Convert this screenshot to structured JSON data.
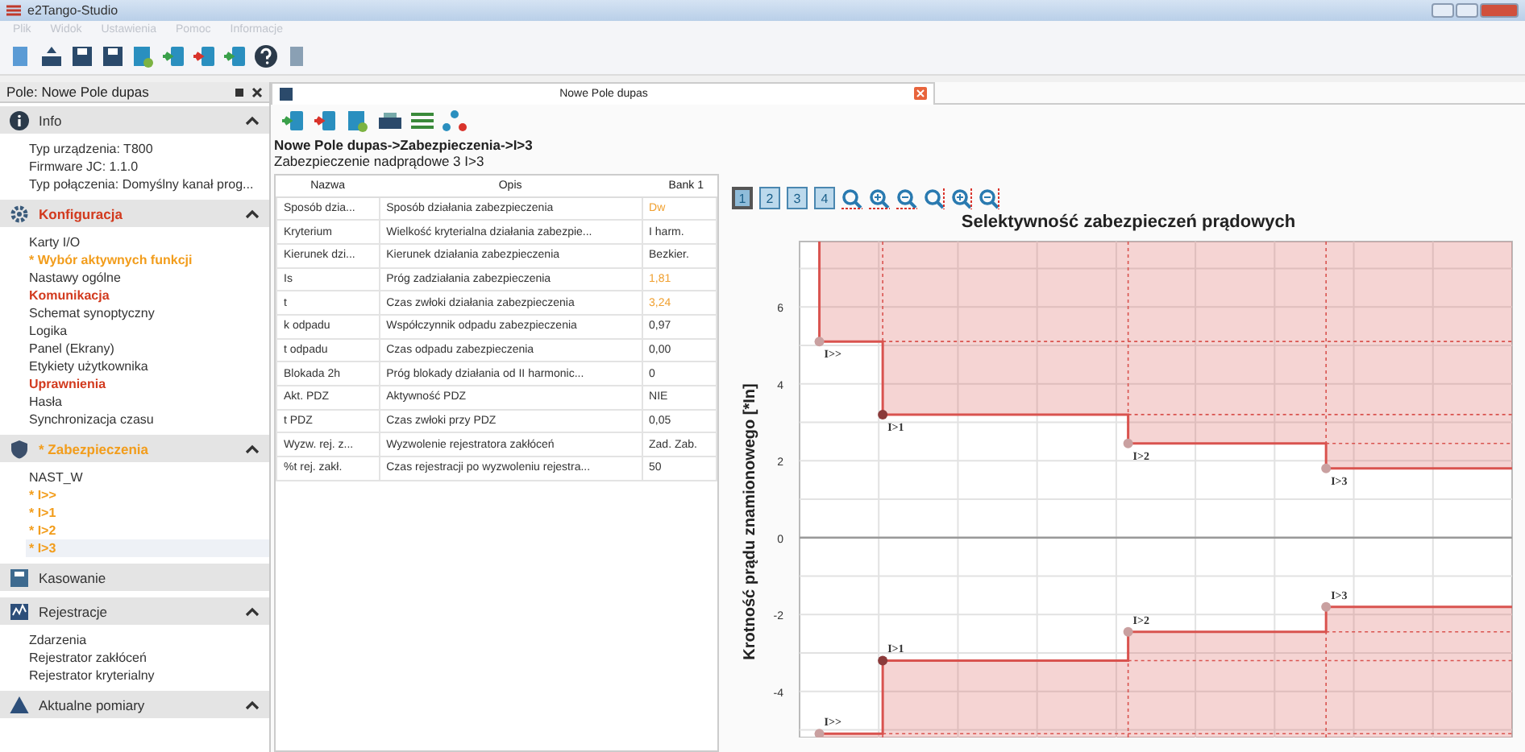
{
  "window": {
    "title": "e2Tango-Studio"
  },
  "menu": [
    "Plik",
    "Widok",
    "Ustawienia",
    "Pomoc",
    "Informacje"
  ],
  "sidebar": {
    "title": "Pole: Nowe Pole dupas",
    "sections": [
      {
        "title": "Info",
        "kind": "normal",
        "expanded": true,
        "items": [
          {
            "label": "Typ urządzenia: T800",
            "kind": "normal",
            "selected": false
          },
          {
            "label": "Firmware JC: 1.1.0",
            "kind": "normal",
            "selected": false
          },
          {
            "label": "Typ połączenia: Domyślny kanał prog...",
            "kind": "normal",
            "selected": false
          }
        ]
      },
      {
        "title": "Konfiguracja",
        "kind": "error",
        "expanded": true,
        "items": [
          {
            "label": "Karty I/O",
            "kind": "normal",
            "selected": false
          },
          {
            "label": "* Wybór aktywnych funkcji",
            "kind": "modified",
            "selected": false
          },
          {
            "label": "Nastawy ogólne",
            "kind": "normal",
            "selected": false
          },
          {
            "label": "Komunikacja",
            "kind": "error",
            "selected": false
          },
          {
            "label": "Schemat synoptyczny",
            "kind": "normal",
            "selected": false
          },
          {
            "label": "Logika",
            "kind": "normal",
            "selected": false
          },
          {
            "label": "Panel (Ekrany)",
            "kind": "normal",
            "selected": false
          },
          {
            "label": "Etykiety użytkownika",
            "kind": "normal",
            "selected": false
          },
          {
            "label": "Uprawnienia",
            "kind": "error",
            "selected": false
          },
          {
            "label": "Hasła",
            "kind": "normal",
            "selected": false
          },
          {
            "label": "Synchronizacja czasu",
            "kind": "normal",
            "selected": false
          }
        ]
      },
      {
        "title": "* Zabezpieczenia",
        "kind": "modified",
        "expanded": true,
        "items": [
          {
            "label": "NAST_W",
            "kind": "normal",
            "selected": false
          },
          {
            "label": "* I>>",
            "kind": "modified",
            "selected": false
          },
          {
            "label": "* I>1",
            "kind": "modified",
            "selected": false
          },
          {
            "label": "* I>2",
            "kind": "modified",
            "selected": false
          },
          {
            "label": "* I>3",
            "kind": "modified",
            "selected": true
          }
        ]
      },
      {
        "title": "Kasowanie",
        "kind": "normal",
        "expanded": false
      },
      {
        "title": "Rejestracje",
        "kind": "normal",
        "expanded": true,
        "items": [
          {
            "label": "Zdarzenia",
            "kind": "normal",
            "selected": false
          },
          {
            "label": "Rejestrator zakłóceń",
            "kind": "normal",
            "selected": false
          },
          {
            "label": "Rejestrator kryterialny",
            "kind": "normal",
            "selected": false
          }
        ]
      },
      {
        "title": "Aktualne pomiary",
        "kind": "normal",
        "expanded": true
      }
    ]
  },
  "document": {
    "tab": {
      "title": "Nowe Pole dupas",
      "selected": true
    },
    "breadcrumb": "Nowe Pole dupas->Zabezpieczenia->I>3",
    "subtitle": "Zabezpieczenie nadprądowe 3 I>3",
    "table": {
      "columns": [
        "Nazwa",
        "Opis",
        "Bank 1"
      ],
      "rows": [
        {
          "name": "Sposób dzia...",
          "description": "Sposób działania zabezpieczenia",
          "value": "Dw",
          "modified": true
        },
        {
          "name": "Kryterium",
          "description": "Wielkość kryterialna działania zabezpie...",
          "value": "I harm.",
          "modified": false
        },
        {
          "name": "Kierunek dzi...",
          "description": "Kierunek działania zabezpieczenia",
          "value": "Bezkier.",
          "modified": false
        },
        {
          "name": "Is",
          "description": "Próg zadziałania zabezpieczenia",
          "value": "1,81",
          "modified": true
        },
        {
          "name": "t",
          "description": "Czas zwłoki działania zabezpieczenia",
          "value": "3,24",
          "modified": true
        },
        {
          "name": "k odpadu",
          "description": "Współczynnik odpadu zabezpieczenia",
          "value": "0,97",
          "modified": false
        },
        {
          "name": "t odpadu",
          "description": "Czas odpadu zabezpieczenia",
          "value": "0,00",
          "modified": false
        },
        {
          "name": "Blokada 2h",
          "description": "Próg blokady działania od II harmonic...",
          "value": "0",
          "modified": false
        },
        {
          "name": "Akt. PDZ",
          "description": "Aktywność PDZ",
          "value": "NIE",
          "modified": false
        },
        {
          "name": "t PDZ",
          "description": "Czas zwłoki przy PDZ",
          "value": "0,05",
          "modified": false
        },
        {
          "name": "Wyzw. rej. z...",
          "description": "Wyzwolenie rejestratora zakłóceń",
          "value": "Zad. Zab.",
          "modified": false
        },
        {
          "name": "%t rej. zakł.",
          "description": "Czas rejestracji po wyzwoleniu rejestra...",
          "value": "50",
          "modified": false
        }
      ]
    },
    "chart_buttons": [
      {
        "label": "1",
        "selected": true
      },
      {
        "label": "2",
        "selected": false
      },
      {
        "label": "3",
        "selected": false
      },
      {
        "label": "4",
        "selected": false
      }
    ],
    "chart": {
      "title": "Selektywność zabezpieczeń prądowych",
      "ylabel": "Krotność prądu znamionowego [*In]",
      "tick_labels": [
        "6",
        "4",
        "2",
        "0",
        "-2",
        "-4"
      ],
      "upper_labels": [
        "I>>",
        "I>1",
        "I>2",
        "I>3"
      ],
      "lower_labels": [
        "I>>",
        "I>1",
        "I>2",
        "I>3"
      ]
    }
  }
}
